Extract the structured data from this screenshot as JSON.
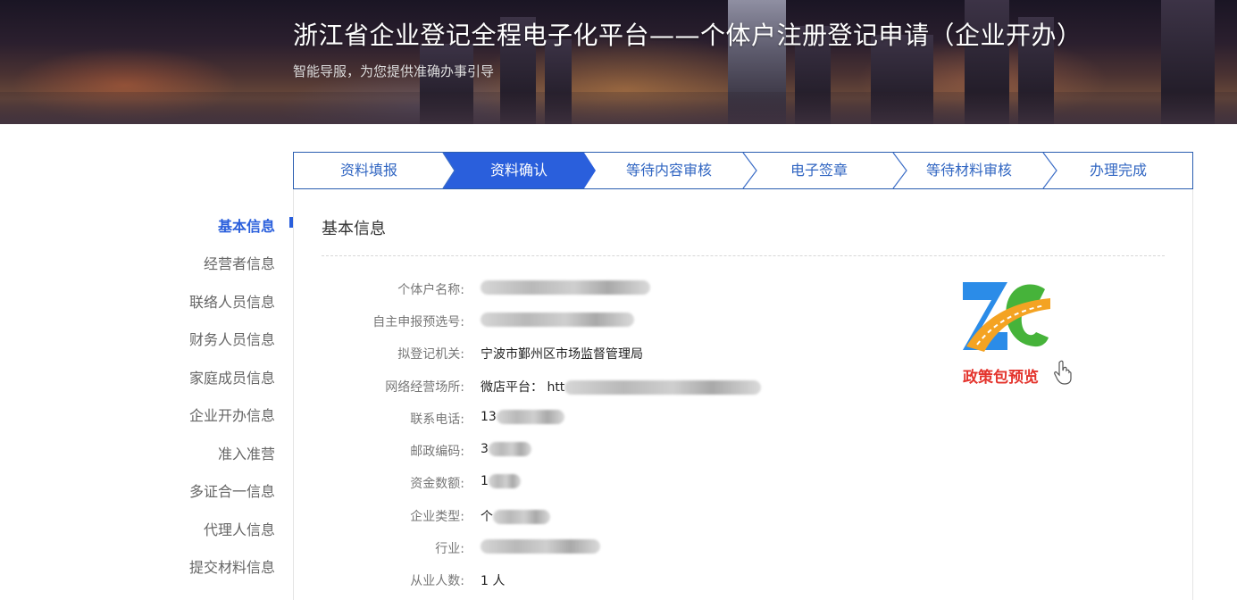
{
  "header": {
    "title": "浙江省企业登记全程电子化平台——个体户注册登记申请（企业开办）",
    "subtitle": "智能导服，为您提供准确办事引导"
  },
  "steps": [
    {
      "label": "资料填报",
      "active": false
    },
    {
      "label": "资料确认",
      "active": true
    },
    {
      "label": "等待内容审核",
      "active": false
    },
    {
      "label": "电子签章",
      "active": false
    },
    {
      "label": "等待材料审核",
      "active": false
    },
    {
      "label": "办理完成",
      "active": false
    }
  ],
  "sidebar": {
    "items": [
      {
        "label": "基本信息",
        "active": true
      },
      {
        "label": "经营者信息"
      },
      {
        "label": "联络人员信息"
      },
      {
        "label": "财务人员信息"
      },
      {
        "label": "家庭成员信息"
      },
      {
        "label": "企业开办信息"
      },
      {
        "label": "准入准营"
      },
      {
        "label": "多证合一信息"
      },
      {
        "label": "代理人信息"
      },
      {
        "label": "提交材料信息"
      }
    ]
  },
  "section": {
    "title": "基本信息",
    "fields": [
      {
        "label": "个体户名称:",
        "value": ""
      },
      {
        "label": "自主申报预选号:",
        "value": ""
      },
      {
        "label": "拟登记机关:",
        "value": "宁波市鄞州区市场监督管理局"
      },
      {
        "label": "网络经营场所:",
        "value": "微店平台：  htt"
      },
      {
        "label": "联系电话:",
        "value": "13"
      },
      {
        "label": "邮政编码:",
        "value": "3"
      },
      {
        "label": "资金数额:",
        "value": "1"
      },
      {
        "label": "企业类型:",
        "value": "个"
      },
      {
        "label": "行业:",
        "value": ""
      },
      {
        "label": "从业人数:",
        "value": "1 人"
      }
    ]
  },
  "promo": {
    "caption": "政策包预览",
    "logo_icon": "zc-logo-icon",
    "cursor_icon": "hand-pointer-icon",
    "colors": {
      "blue": "#2b8ce8",
      "green": "#46b33a",
      "orange": "#f4a323",
      "red": "#e4342d"
    }
  }
}
